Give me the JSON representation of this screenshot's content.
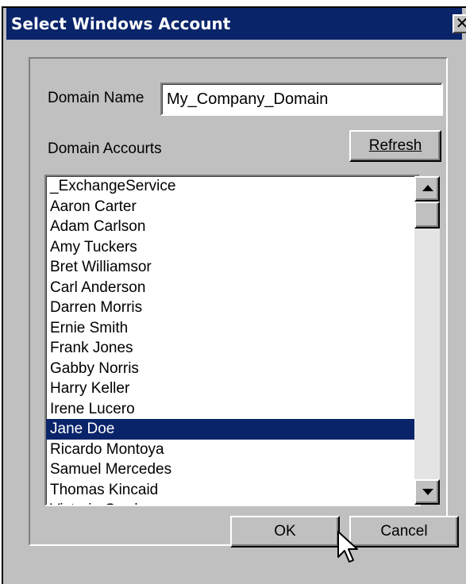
{
  "window": {
    "title": "Select Windows Account",
    "close_glyph": "✕"
  },
  "domain": {
    "label": "Domain Name",
    "value": "My_Company_Domain"
  },
  "accounts": {
    "label": "Domain Accourts",
    "refresh_label": "Refresh",
    "items": [
      "_ExchangeService",
      "Aaron Carter",
      "Adam Carlson",
      "Amy Tuckers",
      "Bret Williamsor",
      "Carl Anderson",
      "Darren Morris",
      "Ernie Smith",
      "Frank Jones",
      "Gabby Norris",
      "Harry Keller",
      "Irene Lucero",
      "Jane Doe",
      "Ricardo Montoya",
      "Samuel Mercedes",
      "Thomas Kincaid",
      "Victoria Gardner"
    ],
    "selected": "Jane Doe"
  },
  "buttons": {
    "ok_label": "OK",
    "cancel_label": "Cancel"
  },
  "icons": {
    "close": "close-icon",
    "scroll_up": "chevron-up-icon",
    "scroll_down": "chevron-down-icon",
    "cursor": "mouse-pointer-icon"
  },
  "colors": {
    "titlebar": "#0a246a",
    "selection": "#0a246a",
    "dialog_face": "#c0c0c0"
  }
}
